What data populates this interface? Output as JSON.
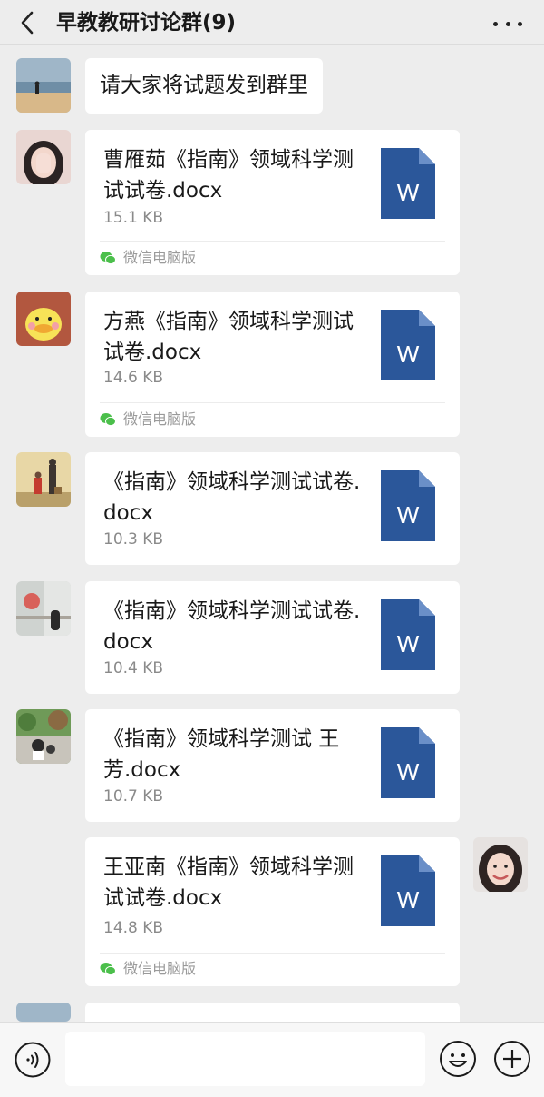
{
  "header": {
    "title": "早教教研讨论群(9)"
  },
  "messages": [
    {
      "type": "text",
      "text": "请大家将试题发到群里"
    },
    {
      "type": "file",
      "name": "曹雁茹《指南》领域科学测试试卷.docx",
      "size": "15.1 KB",
      "source": "微信电脑版"
    },
    {
      "type": "file",
      "name": "方燕《指南》领域科学测试试卷.docx",
      "size": "14.6 KB",
      "source": "微信电脑版"
    },
    {
      "type": "file",
      "name": "《指南》领域科学测试试卷.docx",
      "size": "10.3 KB"
    },
    {
      "type": "file",
      "name": "《指南》领域科学测试试卷.docx",
      "size": "10.4 KB"
    },
    {
      "type": "file",
      "name": "《指南》领域科学测试 王芳.docx",
      "size": "10.7 KB"
    },
    {
      "type": "file",
      "name": "王亚南《指南》领域科学测试试卷.docx",
      "size": "14.8 KB",
      "source": "微信电脑版"
    }
  ],
  "file_icon_label": "W",
  "input": {
    "value": "",
    "placeholder": ""
  },
  "icons": {
    "back": "chevron-left-icon",
    "more": "ellipsis-icon",
    "file": "word-document-icon",
    "source": "wechat-logo-icon",
    "voice": "voice-icon",
    "emoji": "smiley-icon",
    "plus": "plus-circle-icon"
  },
  "colors": {
    "background": "#ededed",
    "bubble": "#ffffff",
    "word_icon": "#2b579a",
    "word_fold": "#6a8fc8",
    "wechat_green": "#4bbf4b",
    "secondary_text": "#8a8a8a"
  }
}
